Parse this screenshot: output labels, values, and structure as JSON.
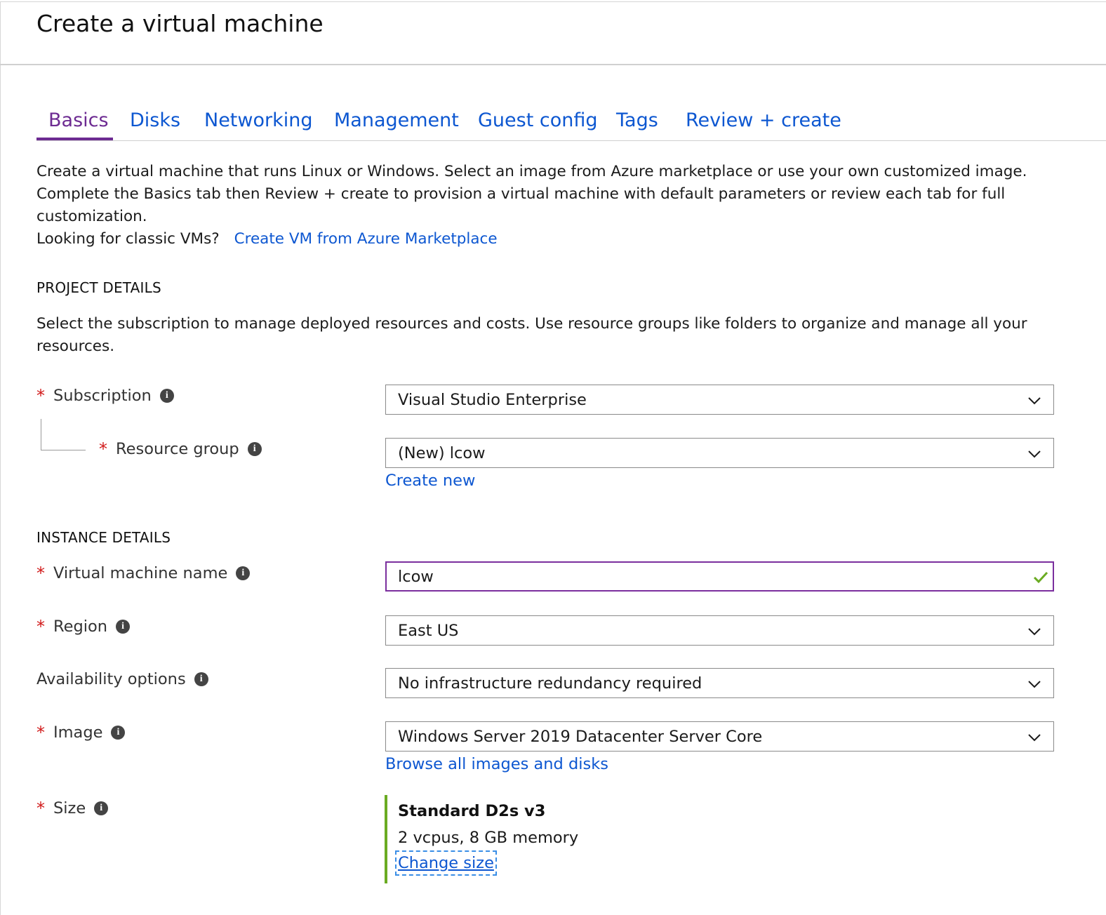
{
  "page": {
    "title": "Create a virtual machine"
  },
  "tabs": [
    {
      "label": "Basics",
      "active": true
    },
    {
      "label": "Disks"
    },
    {
      "label": "Networking"
    },
    {
      "label": "Management"
    },
    {
      "label": "Guest config"
    },
    {
      "label": "Tags"
    },
    {
      "label": "Review + create"
    }
  ],
  "intro": {
    "line1": "Create a virtual machine that runs Linux or Windows. Select an image from Azure marketplace or use your own customized image.",
    "line2": "Complete the Basics tab then Review + create to provision a virtual machine with default parameters or review each tab for full",
    "line3": "customization.",
    "classic_prompt": "Looking for classic VMs?",
    "classic_link": "Create VM from Azure Marketplace"
  },
  "project": {
    "heading": "PROJECT DETAILS",
    "desc1": "Select the subscription to manage deployed resources and costs. Use resource groups like folders to organize and manage all your",
    "desc2": "resources.",
    "subscription": {
      "label": "Subscription",
      "value": "Visual Studio Enterprise"
    },
    "resource_group": {
      "label": "Resource group",
      "value": "(New) lcow",
      "create_new": "Create new"
    }
  },
  "instance": {
    "heading": "INSTANCE DETAILS",
    "vm_name": {
      "label": "Virtual machine name",
      "value": "lcow"
    },
    "region": {
      "label": "Region",
      "value": "East US"
    },
    "availability": {
      "label": "Availability options",
      "value": "No infrastructure redundancy required"
    },
    "image": {
      "label": "Image",
      "value": "Windows Server 2019 Datacenter Server Core",
      "browse": "Browse all images and disks"
    },
    "size": {
      "label": "Size",
      "name": "Standard D2s v3",
      "spec": "2 vcpus, 8 GB memory",
      "change": "Change size"
    }
  },
  "glyphs": {
    "required": "*",
    "info": "i"
  },
  "icons": {
    "dropdown": "chevron-down-icon",
    "info": "info-icon",
    "valid": "checkmark-icon"
  },
  "colors": {
    "link": "#0d57d1",
    "active_tab": "#6d2b92",
    "required": "#d11a1a",
    "valid": "#6aab22"
  }
}
